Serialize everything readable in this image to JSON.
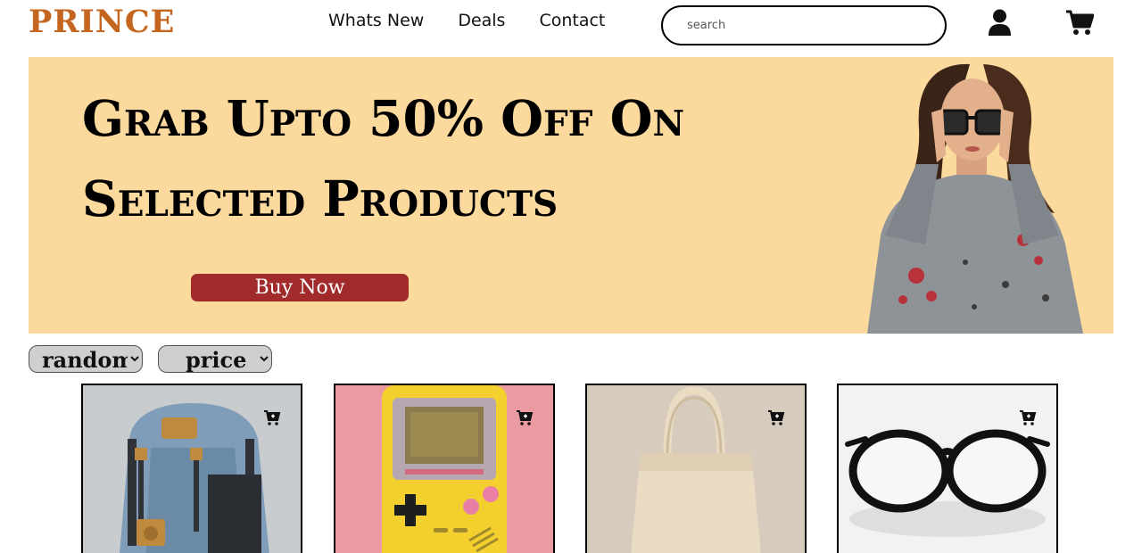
{
  "header": {
    "logo": "PRINCE",
    "nav": [
      "Whats New",
      "Deals",
      "Contact"
    ],
    "search_placeholder": "search",
    "icons": {
      "account": "user-icon",
      "cart": "shopping-cart-icon"
    }
  },
  "banner": {
    "title_line1": "Grab Upto 50% Off On",
    "title_line2": "Selected Products",
    "cta": "Buy Now",
    "image": "woman-wearing-sunglasses"
  },
  "filters": {
    "sort": {
      "selected": "random"
    },
    "price": {
      "selected": "price"
    }
  },
  "products": [
    {
      "image": "backpack",
      "action_icon": "add-to-cart-icon"
    },
    {
      "image": "handheld-game-console",
      "action_icon": "add-to-cart-icon"
    },
    {
      "image": "tote-bag",
      "action_icon": "add-to-cart-icon"
    },
    {
      "image": "eyeglasses",
      "action_icon": "add-to-cart-icon"
    }
  ],
  "colors": {
    "brand": "#c4661f",
    "banner_bg": "#fcd99d",
    "cta_bg": "#a12a2a",
    "filter_bg": "#cfcfcf"
  }
}
